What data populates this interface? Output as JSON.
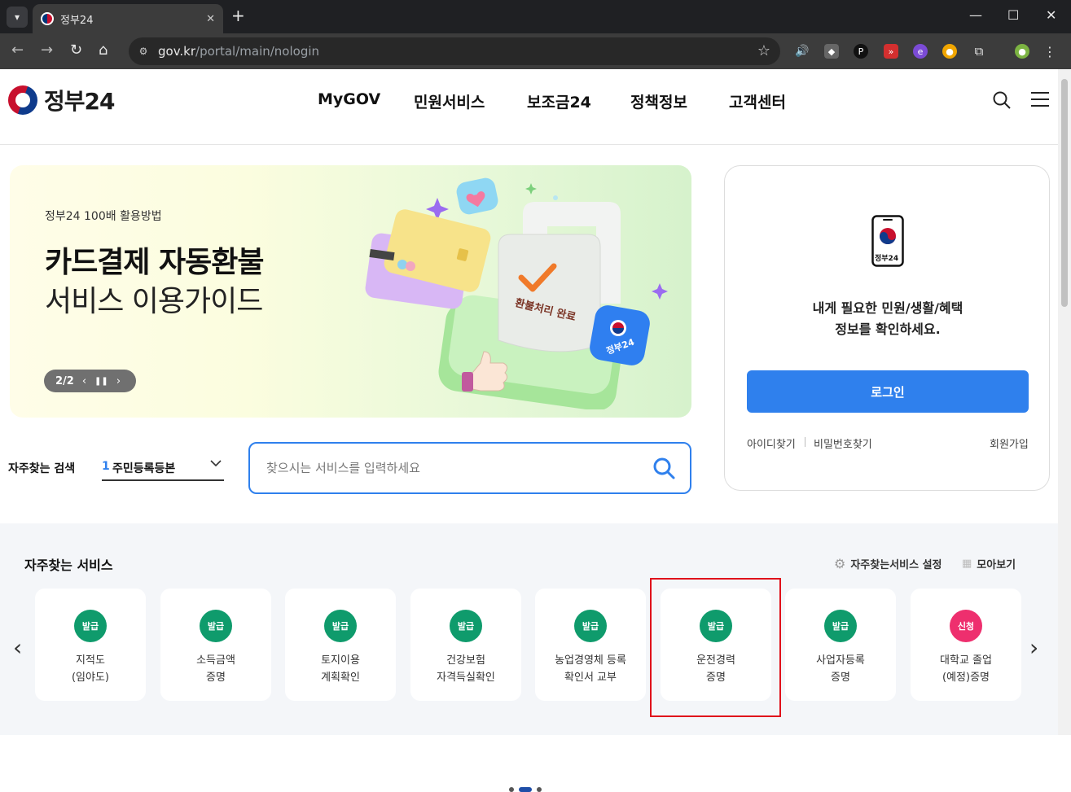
{
  "browser": {
    "tab_title": "정부24",
    "url_host": "gov.kr",
    "url_path": "/portal/main/nologin"
  },
  "header": {
    "logo_text": "정부24",
    "nav": [
      "MyGOV",
      "민원서비스",
      "보조금24",
      "정책정보",
      "고객센터"
    ]
  },
  "banner": {
    "subtitle": "정부24 100배 활용방법",
    "title_line1": "카드결제 자동환불",
    "title_line2": "서비스 이용가이드",
    "pager": "2/2",
    "receipt_text": "환불처리 완료",
    "app_badge_text": "정부24"
  },
  "login": {
    "phone_label": "정부24",
    "message_line1": "내게 필요한 민원/생활/혜택",
    "message_line2": "정보를 확인하세요.",
    "login_button": "로그인",
    "find_id": "아이디찾기",
    "find_pw": "비밀번호찾기",
    "signup": "회원가입"
  },
  "quick_search": {
    "label": "자주찾는 검색",
    "rank": "1",
    "selected": "주민등록등본",
    "placeholder": "찾으시는 서비스를 입력하세요"
  },
  "services": {
    "title": "자주찾는 서비스",
    "settings_label": "자주찾는서비스 설정",
    "view_all_label": "모아보기",
    "items": [
      {
        "badge": "발급",
        "line1": "지적도",
        "line2": "(임야도)"
      },
      {
        "badge": "발급",
        "line1": "소득금액",
        "line2": "증명"
      },
      {
        "badge": "발급",
        "line1": "토지이용",
        "line2": "계획확인"
      },
      {
        "badge": "발급",
        "line1": "건강보험",
        "line2": "자격득실확인"
      },
      {
        "badge": "발급",
        "line1": "농업경영체 등록",
        "line2": "확인서 교부"
      },
      {
        "badge": "발급",
        "line1": "운전경력",
        "line2": "증명"
      },
      {
        "badge": "발급",
        "line1": "사업자등록",
        "line2": "증명"
      },
      {
        "badge": "신청",
        "line1": "대학교 졸업",
        "line2": "(예정)증명"
      }
    ]
  },
  "colors": {
    "issue_badge": "#0f9b6c",
    "apply_badge": "#ee2f6e",
    "primary": "#2f80ed"
  }
}
